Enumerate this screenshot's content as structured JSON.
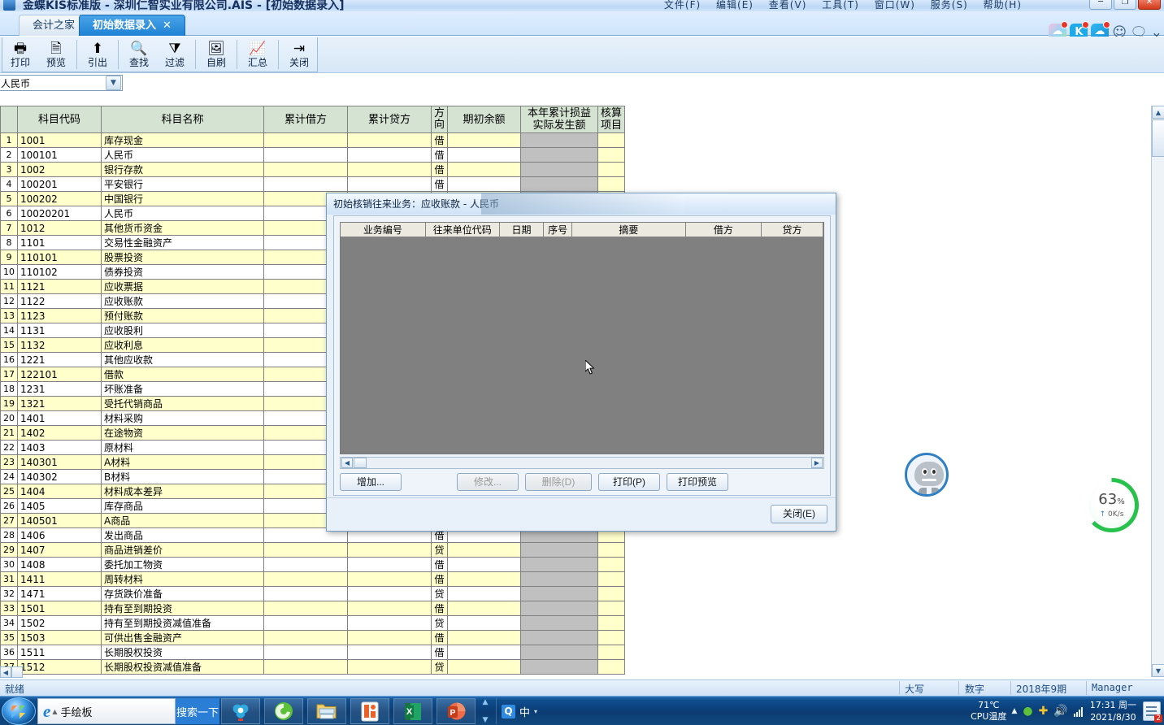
{
  "window": {
    "title": "金蝶KIS标准版 - 深圳仁智实业有限公司.AIS - [初始数据录入]",
    "menus": [
      "文件(F)",
      "编辑(E)",
      "查看(V)",
      "工具(T)",
      "窗口(W)",
      "服务(S)",
      "帮助(H)"
    ],
    "buttons": {
      "minimize": "─",
      "restore": "❐",
      "close": "✕"
    }
  },
  "tabs": [
    {
      "label": "会计之家",
      "active": false
    },
    {
      "label": "初始数据录入",
      "active": true,
      "close": "✕"
    }
  ],
  "toolbar": [
    {
      "label": "打印",
      "icon": "printer-icon",
      "glyph": "🖨"
    },
    {
      "label": "预览",
      "icon": "preview-icon",
      "glyph": "🗋"
    },
    {
      "label": "引出",
      "icon": "export-icon",
      "glyph": "⬆"
    },
    {
      "label": "查找",
      "icon": "find-icon",
      "glyph": "🔍"
    },
    {
      "label": "过滤",
      "icon": "filter-icon",
      "glyph": "▽"
    },
    {
      "label": "自刷",
      "icon": "refresh-icon",
      "glyph": "🖼"
    },
    {
      "label": "汇总",
      "icon": "summary-icon",
      "glyph": "📊"
    },
    {
      "label": "关闭",
      "icon": "exit-icon",
      "glyph": "🚪"
    }
  ],
  "currency": {
    "value": "人民币",
    "arrow": "▼"
  },
  "grid": {
    "headers": [
      "科目代码",
      "科目名称",
      "累计借方",
      "累计贷方",
      "方向",
      "期初余额",
      "本年累计损益实际发生额",
      "核算项目"
    ],
    "header_dir": "方向",
    "header_profit_line1": "本年累计损益",
    "header_profit_line2": "实际发生额",
    "header_item_line1": "核算",
    "header_item_line2": "项目",
    "rows": [
      {
        "n": "1",
        "code": "1001",
        "name": "库存现金",
        "indent": 0,
        "dir": "借"
      },
      {
        "n": "2",
        "code": "100101",
        "name": "人民币",
        "indent": 1,
        "dir": "借"
      },
      {
        "n": "3",
        "code": "1002",
        "name": "银行存款",
        "indent": 0,
        "dir": "借"
      },
      {
        "n": "4",
        "code": "100201",
        "name": "平安银行",
        "indent": 1,
        "dir": "借"
      },
      {
        "n": "5",
        "code": "100202",
        "name": "中国银行",
        "indent": 1,
        "dir": ""
      },
      {
        "n": "6",
        "code": "10020201",
        "name": "人民币",
        "indent": 2,
        "dir": ""
      },
      {
        "n": "7",
        "code": "1012",
        "name": "其他货币资金",
        "indent": 0,
        "dir": ""
      },
      {
        "n": "8",
        "code": "1101",
        "name": "交易性金融资产",
        "indent": 0,
        "dir": ""
      },
      {
        "n": "9",
        "code": "110101",
        "name": "股票投资",
        "indent": 1,
        "dir": ""
      },
      {
        "n": "10",
        "code": "110102",
        "name": "债券投资",
        "indent": 1,
        "dir": ""
      },
      {
        "n": "11",
        "code": "1121",
        "name": "应收票据",
        "indent": 0,
        "dir": ""
      },
      {
        "n": "12",
        "code": "1122",
        "name": "应收账款",
        "indent": 0,
        "dir": ""
      },
      {
        "n": "13",
        "code": "1123",
        "name": "预付账款",
        "indent": 0,
        "dir": ""
      },
      {
        "n": "14",
        "code": "1131",
        "name": "应收股利",
        "indent": 0,
        "dir": ""
      },
      {
        "n": "15",
        "code": "1132",
        "name": "应收利息",
        "indent": 0,
        "dir": ""
      },
      {
        "n": "16",
        "code": "1221",
        "name": "其他应收款",
        "indent": 0,
        "dir": ""
      },
      {
        "n": "17",
        "code": "122101",
        "name": "借款",
        "indent": 1,
        "dir": ""
      },
      {
        "n": "18",
        "code": "1231",
        "name": "坏账准备",
        "indent": 0,
        "dir": ""
      },
      {
        "n": "19",
        "code": "1321",
        "name": "受托代销商品",
        "indent": 0,
        "dir": ""
      },
      {
        "n": "20",
        "code": "1401",
        "name": "材料采购",
        "indent": 0,
        "dir": ""
      },
      {
        "n": "21",
        "code": "1402",
        "name": "在途物资",
        "indent": 0,
        "dir": ""
      },
      {
        "n": "22",
        "code": "1403",
        "name": "原材料",
        "indent": 0,
        "dir": ""
      },
      {
        "n": "23",
        "code": "140301",
        "name": "A材料",
        "indent": 1,
        "dir": ""
      },
      {
        "n": "24",
        "code": "140302",
        "name": "B材料",
        "indent": 1,
        "dir": ""
      },
      {
        "n": "25",
        "code": "1404",
        "name": "材料成本差异",
        "indent": 0,
        "dir": ""
      },
      {
        "n": "26",
        "code": "1405",
        "name": "库存商品",
        "indent": 0,
        "dir": ""
      },
      {
        "n": "27",
        "code": "140501",
        "name": "A商品",
        "indent": 1,
        "dir": ""
      },
      {
        "n": "28",
        "code": "1406",
        "name": "发出商品",
        "indent": 0,
        "dir": "借"
      },
      {
        "n": "29",
        "code": "1407",
        "name": "商品进销差价",
        "indent": 0,
        "dir": "贷"
      },
      {
        "n": "30",
        "code": "1408",
        "name": "委托加工物资",
        "indent": 0,
        "dir": "借"
      },
      {
        "n": "31",
        "code": "1411",
        "name": "周转材料",
        "indent": 0,
        "dir": "借"
      },
      {
        "n": "32",
        "code": "1471",
        "name": "存货跌价准备",
        "indent": 0,
        "dir": "贷"
      },
      {
        "n": "33",
        "code": "1501",
        "name": "持有至到期投资",
        "indent": 0,
        "dir": "借"
      },
      {
        "n": "34",
        "code": "1502",
        "name": "持有至到期投资减值准备",
        "indent": 0,
        "dir": "贷"
      },
      {
        "n": "35",
        "code": "1503",
        "name": "可供出售金融资产",
        "indent": 0,
        "dir": "借"
      },
      {
        "n": "36",
        "code": "1511",
        "name": "长期股权投资",
        "indent": 0,
        "dir": "借"
      },
      {
        "n": "37",
        "code": "1512",
        "name": "长期股权投资减值准备",
        "indent": 0,
        "dir": "贷"
      }
    ]
  },
  "dialog": {
    "title": "初始核销往来业务：应收账款 - 人民币",
    "columns": [
      "业务编号",
      "往来单位代码",
      "日期",
      "序号",
      "摘要",
      "借方",
      "贷方"
    ],
    "rows": [],
    "buttons": [
      {
        "label": "增加...",
        "name": "add-button",
        "disabled": false
      },
      {
        "label": "修改...",
        "name": "modify-button",
        "disabled": true
      },
      {
        "label": "删除(D)",
        "name": "delete-button",
        "disabled": true
      },
      {
        "label": "打印(P)",
        "name": "print-button",
        "disabled": false
      },
      {
        "label": "打印预览",
        "name": "print-preview-button",
        "disabled": false
      }
    ],
    "close_label": "关闭(E)"
  },
  "statusbar": {
    "ready": "就绪",
    "caps": "大写",
    "num": "数字",
    "period": "2018年9期",
    "user": "Manager"
  },
  "widgets": {
    "perf": {
      "percent": "63",
      "percent_symbol": "%",
      "speed": "0K/s",
      "arrow": "↑",
      "color": "#27c24c"
    }
  },
  "taskbar": {
    "ie_label": "手绘板",
    "search_label": "搜索一下",
    "ime": {
      "q": "Q",
      "lang": "中",
      "dropdown": "▾"
    },
    "apps": [
      "browser-360-icon",
      "browser-360se-icon",
      "explorer-icon",
      "wps-icon",
      "excel-icon",
      "powerpoint-icon"
    ],
    "cpu_temp": "71℃",
    "cpu_label": "CPU温度",
    "time": "17:31 周一",
    "date": "2021/8/30",
    "notif_badge": "2"
  }
}
